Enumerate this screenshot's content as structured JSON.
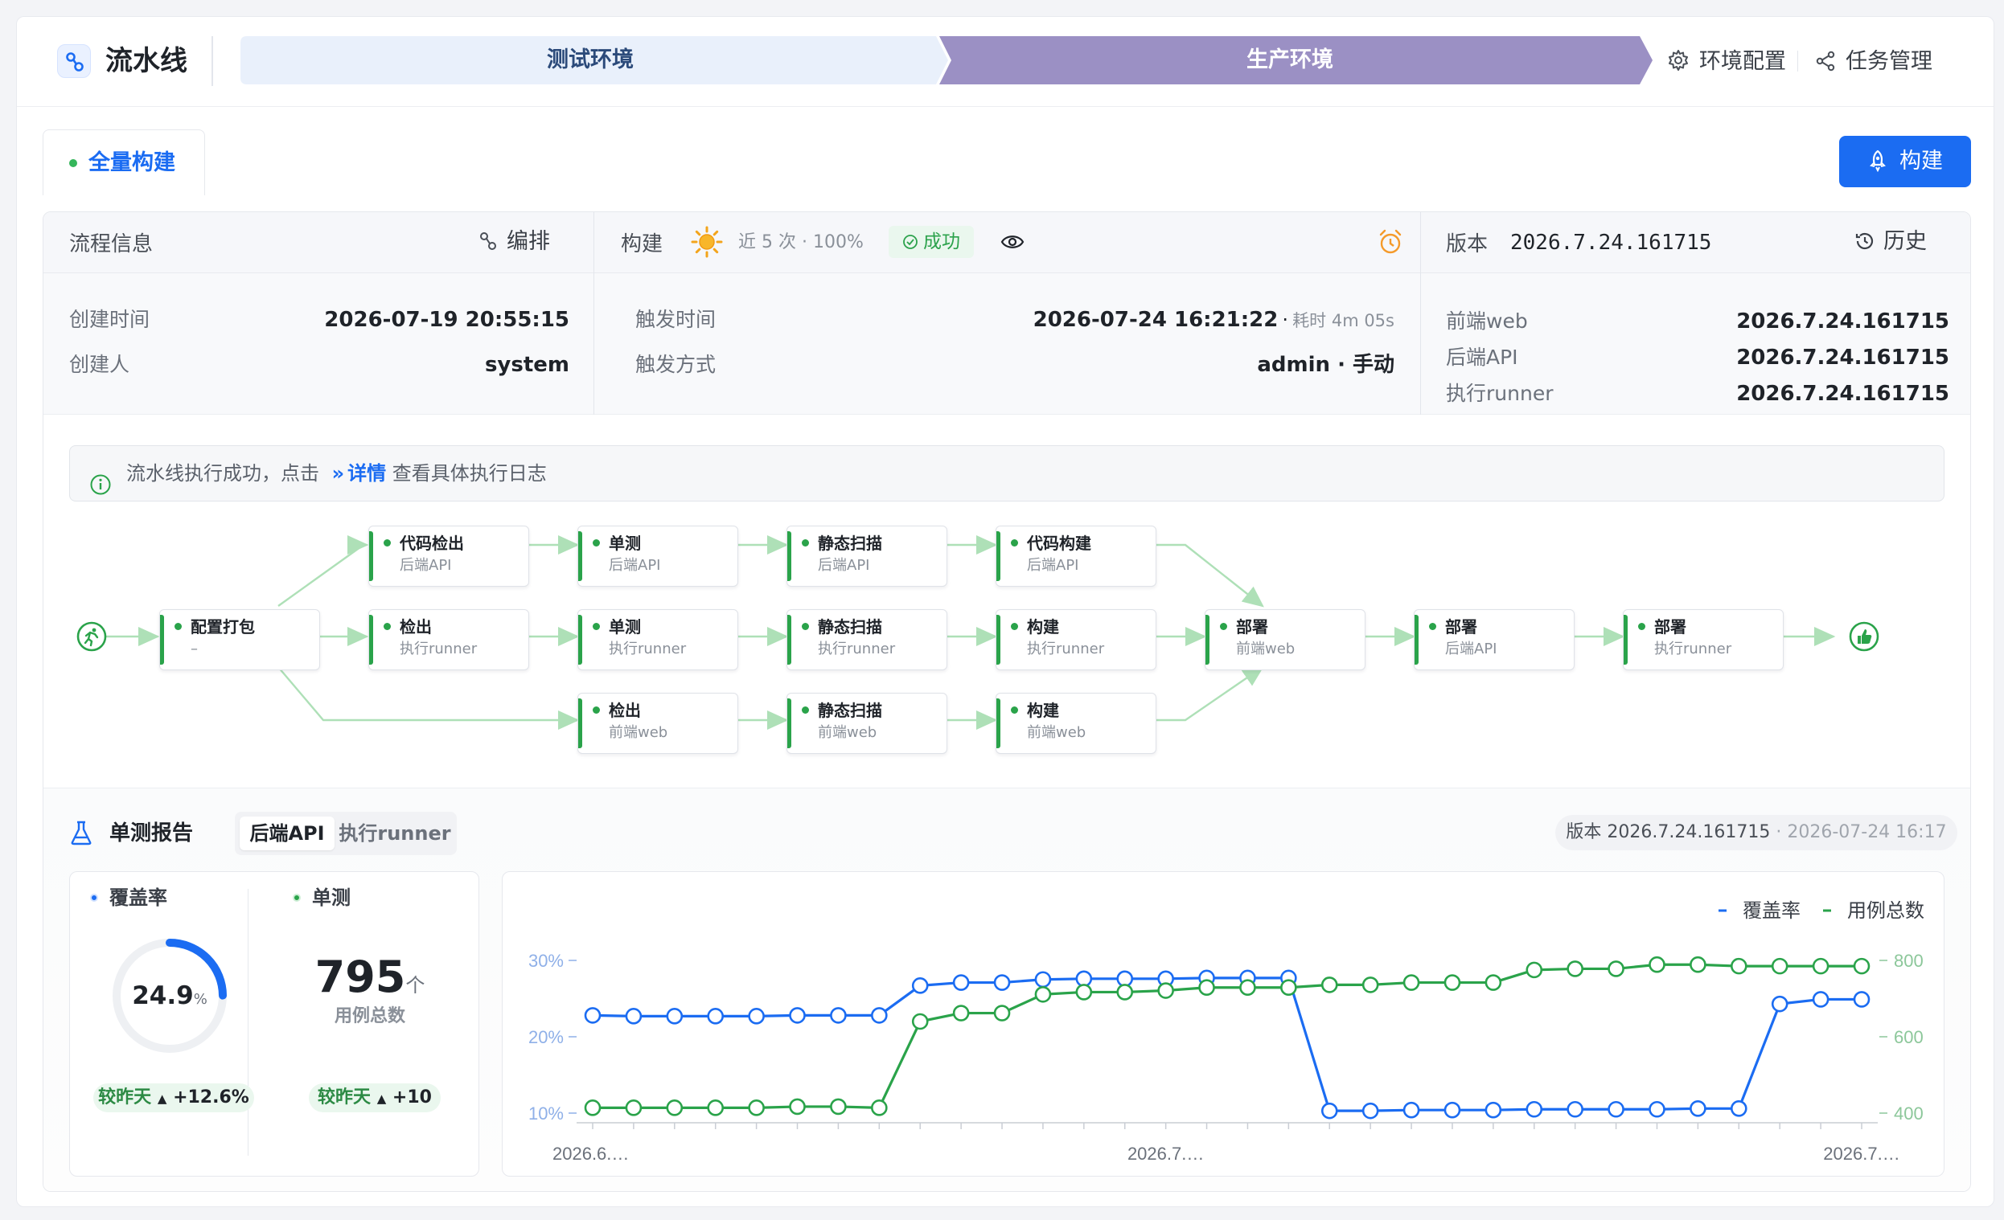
{
  "header": {
    "title": "流水线",
    "stages": [
      {
        "label": "测试环境",
        "state": "normal"
      },
      {
        "label": "生产环境",
        "state": "active"
      }
    ],
    "links": [
      {
        "label": "环境配置",
        "icon": "gear-icon"
      },
      {
        "label": "任务管理",
        "icon": "share-icon"
      }
    ]
  },
  "tabs": [
    {
      "label": "全量构建",
      "status_color": "#35b65b"
    }
  ],
  "build_button": {
    "label": "构建",
    "icon": "rocket-icon"
  },
  "flow_info": {
    "title": "流程信息",
    "edit_label": "编排",
    "created_time_label": "创建时间",
    "created_time": "2026-07-19 20:55:15",
    "creator_label": "创建人",
    "creator": "system"
  },
  "build_info": {
    "title": "构建",
    "weather_icon": "sun-icon",
    "recent": "近 5 次 · 100%",
    "status": "成功",
    "trigger_time_label": "触发时间",
    "trigger_time": "2026-07-24 16:21:22",
    "duration_sep": "·",
    "duration": "耗时 4m 05s",
    "trigger_mode_label": "触发方式",
    "trigger_mode": "admin · 手动"
  },
  "version_info": {
    "title": "版本",
    "version": "2026.7.24.161715",
    "history_label": "历史",
    "components": [
      {
        "name": "前端web",
        "version": "2026.7.24.161715"
      },
      {
        "name": "后端API",
        "version": "2026.7.24.161715"
      },
      {
        "name": "执行runner",
        "version": "2026.7.24.161715"
      }
    ]
  },
  "alert": {
    "prefix": "流水线执行成功，点击",
    "link": "详情",
    "suffix": "查看具体执行日志"
  },
  "pipeline": {
    "nodes": [
      {
        "id": "config",
        "title": "配置打包",
        "sub": "–"
      },
      {
        "id": "b1",
        "title": "代码检出",
        "sub": "后端API"
      },
      {
        "id": "b2",
        "title": "单测",
        "sub": "后端API"
      },
      {
        "id": "b3",
        "title": "静态扫描",
        "sub": "后端API"
      },
      {
        "id": "b4",
        "title": "代码构建",
        "sub": "后端API"
      },
      {
        "id": "r1",
        "title": "检出",
        "sub": "执行runner"
      },
      {
        "id": "r2",
        "title": "单测",
        "sub": "执行runner"
      },
      {
        "id": "r3",
        "title": "静态扫描",
        "sub": "执行runner"
      },
      {
        "id": "r4",
        "title": "构建",
        "sub": "执行runner"
      },
      {
        "id": "w1",
        "title": "检出",
        "sub": "前端web"
      },
      {
        "id": "w2",
        "title": "静态扫描",
        "sub": "前端web"
      },
      {
        "id": "w3",
        "title": "构建",
        "sub": "前端web"
      },
      {
        "id": "d1",
        "title": "部署",
        "sub": "前端web"
      },
      {
        "id": "d2",
        "title": "部署",
        "sub": "后端API"
      },
      {
        "id": "d3",
        "title": "部署",
        "sub": "执行runner"
      }
    ]
  },
  "report": {
    "title": "单测报告",
    "segments": [
      {
        "label": "后端API",
        "active": true
      },
      {
        "label": "执行runner",
        "active": false
      }
    ],
    "version_prefix": "版本 2026.7.24.161715",
    "version_time": "· 2026-07-24 16:17",
    "coverage": {
      "label": "覆盖率",
      "value": 24.9,
      "value_text": "24.9",
      "unit": "%",
      "delta_label": "较昨天",
      "delta": "+12.6%",
      "color": "#1b6cf2"
    },
    "tests": {
      "label": "单测",
      "value": "795",
      "unit": "个",
      "sub": "用例总数",
      "delta_label": "较昨天",
      "delta": "+10",
      "color": "#2aa34a"
    }
  },
  "chart_data": {
    "type": "line",
    "x_tick_labels": [
      "2026.6.…",
      "2026.7.…",
      "2026.7.…"
    ],
    "legend": [
      "覆盖率",
      "用例总数"
    ],
    "legend_position": "top-right",
    "y_left": {
      "ticks": [
        "10%",
        "20%",
        "30%"
      ],
      "range": [
        10,
        30
      ]
    },
    "y_right": {
      "ticks": [
        "400",
        "600",
        "800"
      ],
      "range": [
        400,
        800
      ]
    },
    "series": [
      {
        "name": "覆盖率",
        "axis": "left",
        "color": "#1b6cf2",
        "values": [
          22.8,
          22.7,
          22.7,
          22.7,
          22.7,
          22.8,
          22.8,
          22.8,
          26.7,
          27.1,
          27.1,
          27.5,
          27.6,
          27.6,
          27.6,
          27.7,
          27.7,
          27.7,
          10.3,
          10.3,
          10.4,
          10.4,
          10.4,
          10.5,
          10.5,
          10.5,
          10.5,
          10.6,
          10.6,
          24.3,
          24.9,
          24.9
        ]
      },
      {
        "name": "用例总数",
        "axis": "right",
        "color": "#2aa34a",
        "values": [
          414,
          414,
          414,
          414,
          414,
          417,
          417,
          414,
          640,
          662,
          662,
          711,
          717,
          717,
          721,
          729,
          729,
          729,
          736,
          736,
          742,
          742,
          742,
          775,
          778,
          778,
          789,
          789,
          785,
          785,
          785,
          785
        ]
      }
    ]
  }
}
